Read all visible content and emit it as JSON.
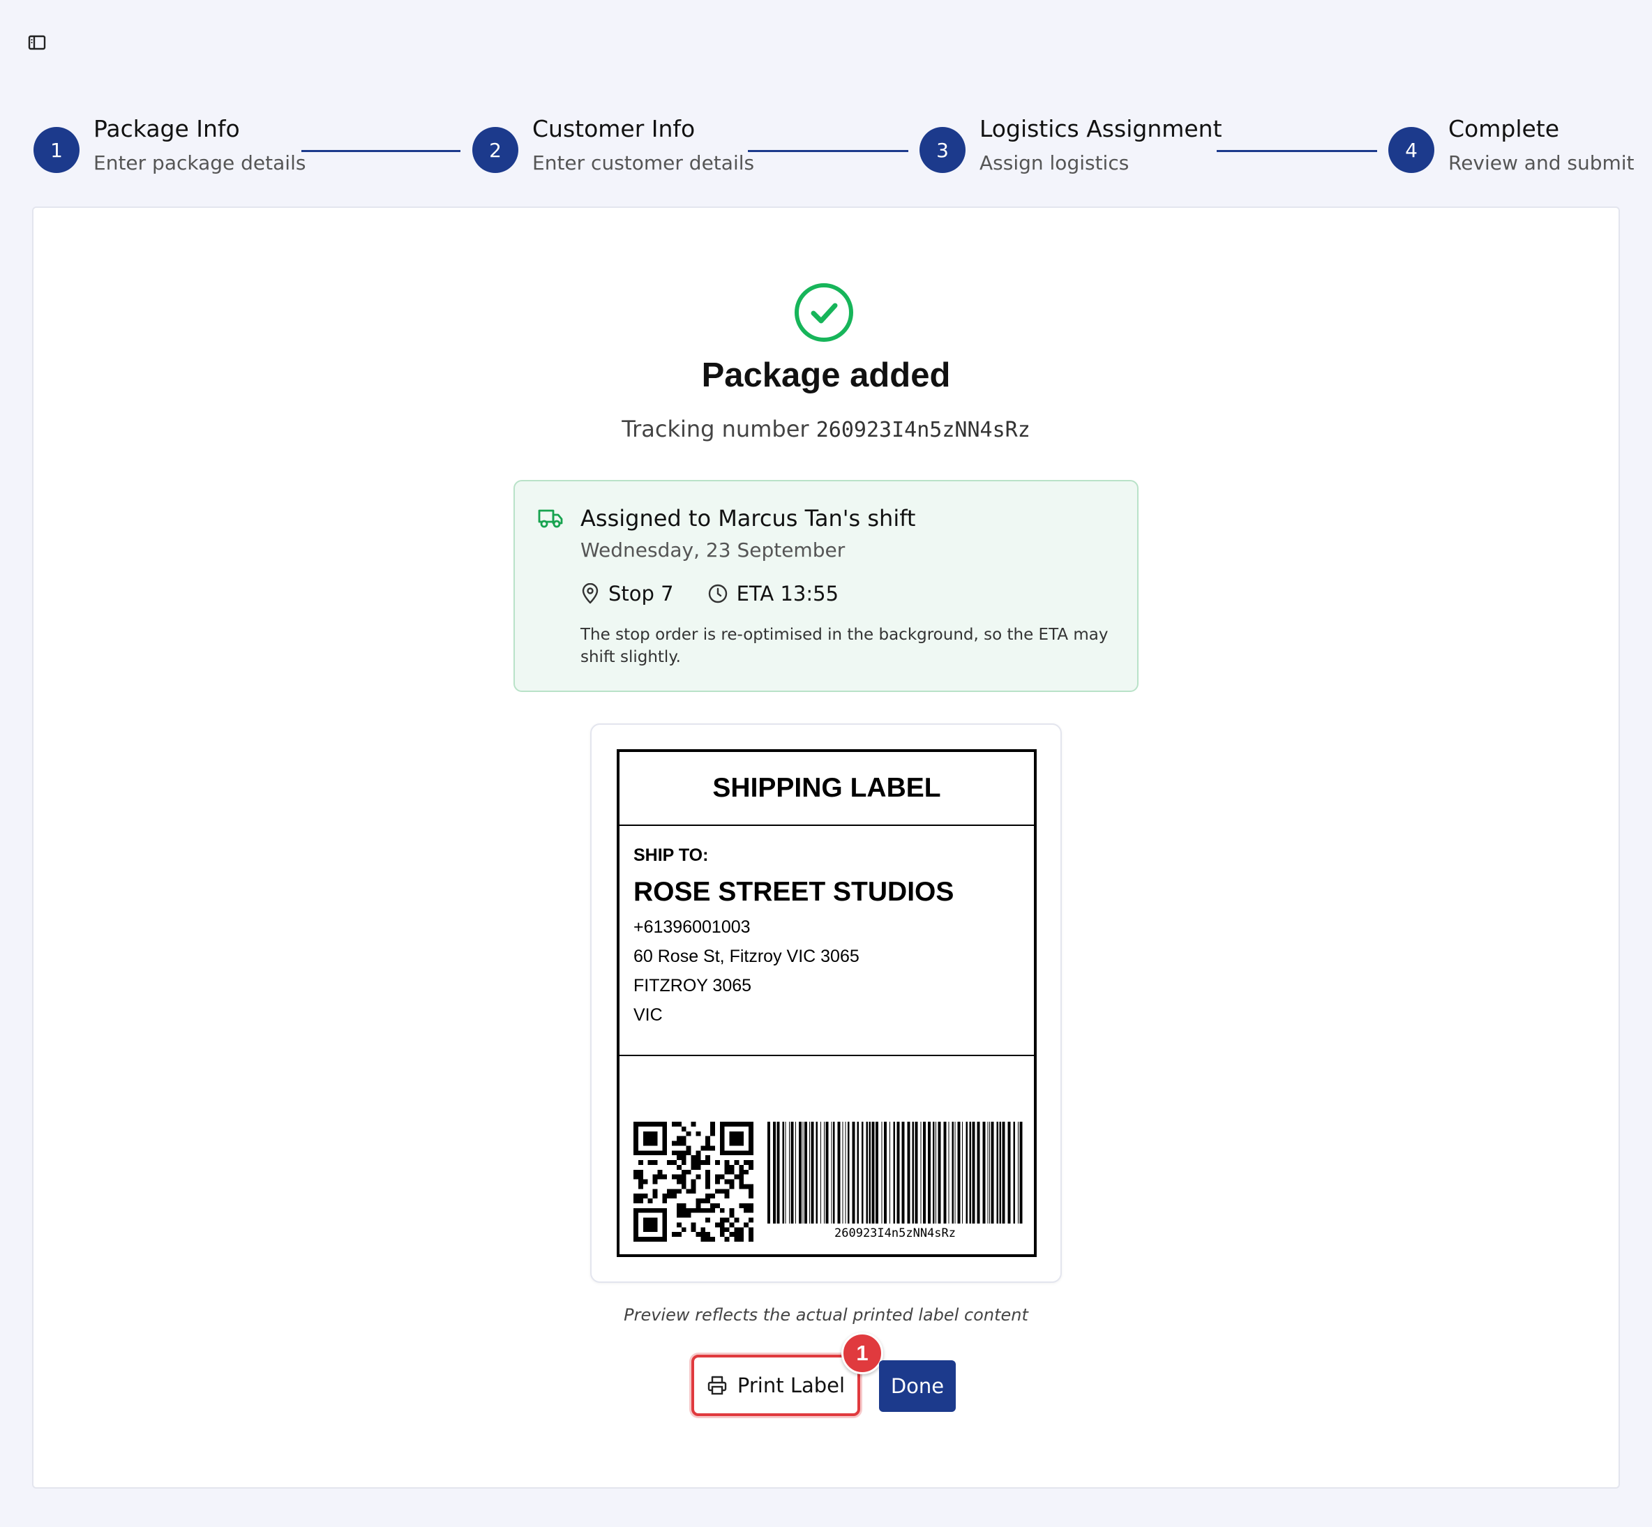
{
  "sidebar": {
    "toggle_icon": "sidebar-toggle-icon"
  },
  "stepper": {
    "steps": [
      {
        "number": "1",
        "title": "Package Info",
        "description": "Enter package details"
      },
      {
        "number": "2",
        "title": "Customer Info",
        "description": "Enter customer details"
      },
      {
        "number": "3",
        "title": "Logistics Assignment",
        "description": "Assign logistics"
      },
      {
        "number": "4",
        "title": "Complete",
        "description": "Review and submit"
      }
    ],
    "accent_color": "#1c3a8c"
  },
  "result": {
    "icon": "check-circle-icon",
    "headline": "Package added",
    "tracking_label": "Tracking number",
    "tracking_number": "260923I4n5zNN4sRz",
    "success_color": "#17b55a"
  },
  "assignment": {
    "icon": "truck-icon",
    "title": "Assigned to Marcus Tan's shift",
    "date": "Wednesday, 23 September",
    "stop": "Stop 7",
    "eta": "ETA 13:55",
    "note": "The stop order is re-optimised in the background, so the ETA may shift slightly."
  },
  "label": {
    "header": "SHIPPING LABEL",
    "ship_to_caption": "SHIP TO:",
    "recipient_name": "ROSE STREET STUDIOS",
    "phone": "+61396001003",
    "address_line": "60 Rose St, Fitzroy VIC 3065",
    "city_postcode": "FITZROY 3065",
    "state": "VIC",
    "barcode_text": "260923I4n5zNN4sRz"
  },
  "preview_caption": "Preview reflects the actual printed label content",
  "actions": {
    "print_label": "Print Label",
    "done": "Done",
    "marker": "1",
    "highlight_color": "#e03a3e"
  }
}
